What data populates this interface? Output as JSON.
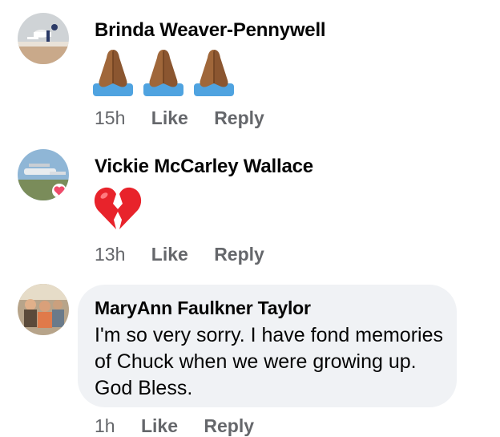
{
  "comments": [
    {
      "author": "Brinda Weaver-Pennywell",
      "emoji": "🙏🏾🙏🏾🙏🏾",
      "emoji_icon": "folded-hands-icon",
      "time": "15h",
      "like": "Like",
      "reply": "Reply"
    },
    {
      "author": "Vickie McCarley Wallace",
      "emoji": "💔",
      "emoji_icon": "broken-heart-icon",
      "time": "13h",
      "like": "Like",
      "reply": "Reply"
    },
    {
      "author": "MaryAnn Faulkner Taylor",
      "text": "I'm so very sorry. I have fond memories of Chuck when we were growing up. God Bless.",
      "time": "1h",
      "like": "Like",
      "reply": "Reply"
    }
  ],
  "colors": {
    "bubble": "#f0f2f5",
    "meta_text": "#65676b",
    "broken_heart": "#e8232b",
    "hands_skin": "#a0673a",
    "hands_sleeve": "#4fa3e0"
  }
}
